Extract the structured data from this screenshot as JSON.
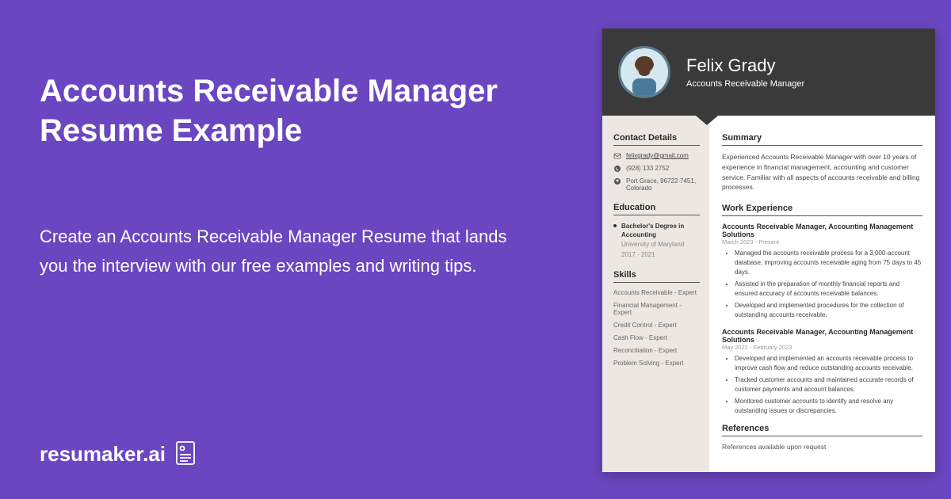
{
  "hero": {
    "title": "Accounts Receivable Manager Resume Example",
    "subtitle": "Create an Accounts Receivable Manager Resume that lands you the interview with our free examples and writing tips."
  },
  "brand": {
    "name": "resumaker.ai"
  },
  "resume": {
    "name": "Felix Grady",
    "title": "Accounts Receivable Manager",
    "sections": {
      "contact_heading": "Contact Details",
      "education_heading": "Education",
      "skills_heading": "Skills",
      "summary_heading": "Summary",
      "work_heading": "Work Experience",
      "refs_heading": "References"
    },
    "contact": {
      "email": "felixgrady@gmail.com",
      "phone": "(928) 133 2752",
      "address": "Port Grace, 96722-7451, Colorado"
    },
    "education": {
      "degree": "Bachelor's Degree in Accounting",
      "school": "University of Maryland",
      "dates": "2017 - 2021"
    },
    "skills": [
      "Accounts Receivable - Expert",
      "Financial Management - Expert",
      "Credit Control - Expert",
      "Cash Flow - Expert",
      "Reconciliation - Expert",
      "Problem Solving - Expert"
    ],
    "summary": "Experienced Accounts Receivable Manager with over 10 years of experience in financial management, accounting and customer service. Familiar with all aspects of accounts receivable and billing processes.",
    "jobs": [
      {
        "title": "Accounts Receivable Manager, Accounting Management Solutions",
        "dates": "March 2023 - Present",
        "bullets": [
          "Managed the accounts receivable process for a 3,000-account database, improving accounts receivable aging from 75 days to 45 days.",
          "Assisted in the preparation of monthly financial reports and ensured accuracy of accounts receivable balances.",
          "Developed and implemented procedures for the collection of outstanding accounts receivable."
        ]
      },
      {
        "title": "Accounts Receivable Manager, Accounting Management Solutions",
        "dates": "May 2021 - February 2023",
        "bullets": [
          "Developed and implemented an accounts receivable process to improve cash flow and reduce outstanding accounts receivable.",
          "Tracked customer accounts and maintained accurate records of customer payments and account balances.",
          "Monitored customer accounts to identify and resolve any outstanding issues or discrepancies."
        ]
      }
    ],
    "references": "References available upon request"
  }
}
